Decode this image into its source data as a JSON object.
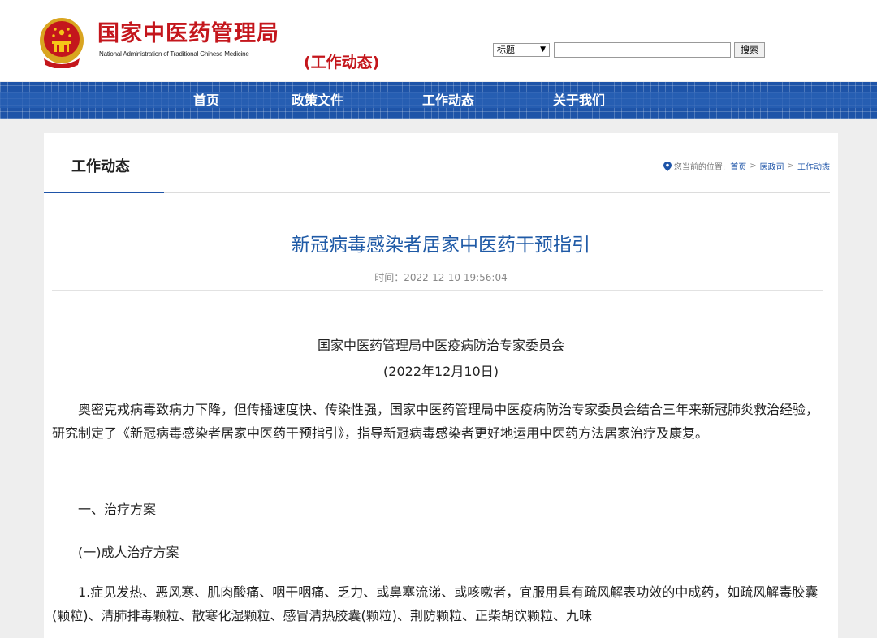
{
  "header": {
    "site_name": "国家中医药管理局",
    "site_name_en": "National Administration of Traditional Chinese Medicine",
    "section": "(工作动态)"
  },
  "search": {
    "select_value": "标题",
    "button_label": "搜索"
  },
  "nav": {
    "items": [
      {
        "label": "首页"
      },
      {
        "label": "政策文件"
      },
      {
        "label": "工作动态"
      },
      {
        "label": "关于我们"
      }
    ]
  },
  "panel": {
    "title": "工作动态"
  },
  "breadcrumb": {
    "prefix": "您当前的位置:",
    "items": [
      "首页",
      "医政司",
      "工作动态"
    ],
    "separator": ">"
  },
  "article": {
    "title": "新冠病毒感染者居家中医药干预指引",
    "time": "时间：2022-12-10 19:56:04",
    "org": "国家中医药管理局中医疫病防治专家委员会",
    "date": "(2022年12月10日)",
    "paragraphs": [
      "奥密克戎病毒致病力下降，但传播速度快、传染性强，国家中医药管理局中医疫病防治专家委员会结合三年来新冠肺炎救治经验，研究制定了《新冠病毒感染者居家中医药干预指引》，指导新冠病毒感染者更好地运用中医药方法居家治疗及康复。",
      "一、治疗方案",
      "(一)成人治疗方案",
      "1.症见发热、恶风寒、肌肉酸痛、咽干咽痛、乏力、或鼻塞流涕、或咳嗽者，宜服用具有疏风解表功效的中成药，如疏风解毒胶囊(颗粒)、清肺排毒颗粒、散寒化湿颗粒、感冒清热胶囊(颗粒)、荆防颗粒、正柴胡饮颗粒、九味"
    ]
  },
  "colors": {
    "brand_red": "#c4161c",
    "nav_blue": "#1e54a8",
    "title_blue": "#1f5aa6"
  }
}
